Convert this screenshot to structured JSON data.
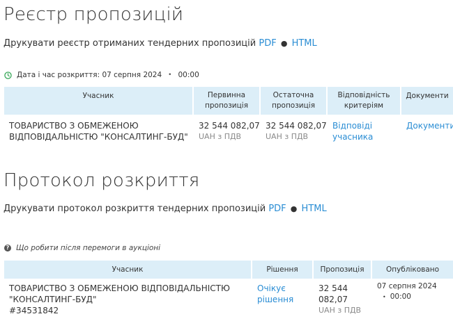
{
  "registry": {
    "title": "Реєстр пропозицій",
    "print_text": "Друкувати реєстр отриманих тендерних пропозицій",
    "pdf_label": "PDF",
    "html_label": "HTML",
    "opening_label": "Дата і час розкриття: 07 серпня 2024",
    "opening_time": "00:00",
    "headers": {
      "participant": "Учасник",
      "initial": "Первинна пропозиція",
      "final": "Остаточна пропозиція",
      "criteria": "Відповідність критеріям",
      "documents": "Документи"
    },
    "rows": [
      {
        "participant": "ТОВАРИСТВО З ОБМЕЖЕНОЮ ВІДПОВІДАЛЬНІСТЮ \"КОНСАЛТИНГ-БУД\"",
        "initial_amount": "32 544 082,07",
        "initial_currency": "UAH з ПДВ",
        "final_amount": "32 544 082,07",
        "final_currency": "UAH з ПДВ",
        "criteria_link": "Відповіді учасника",
        "documents_link": "Документи"
      }
    ]
  },
  "protocol": {
    "title": "Протокол розкриття",
    "print_text": "Друкувати протокол розкриття тендерних пропозицій",
    "pdf_label": "PDF",
    "html_label": "HTML",
    "help_text": "Що робити після перемоги в аукціоні",
    "headers": {
      "participant": "Учасник",
      "decision": "Рішення",
      "offer": "Пропозиція",
      "published": "Опубліковано"
    },
    "rows": [
      {
        "participant": "ТОВАРИСТВО З ОБМЕЖЕНОЮ ВІДПОВІДАЛЬНІСТЮ \"КОНСАЛТИНГ-БУД\"",
        "participant_id": "#34531842",
        "decision_link": "Очікує рішення",
        "offer_amount": "32 544 082,07",
        "offer_currency": "UAH з ПДВ",
        "published_date": "07 серпня 2024",
        "published_time": "00:00"
      }
    ]
  },
  "colors": {
    "link": "#2a8dd4",
    "header_bg": "#dceef8",
    "muted": "#8a8a8a"
  }
}
